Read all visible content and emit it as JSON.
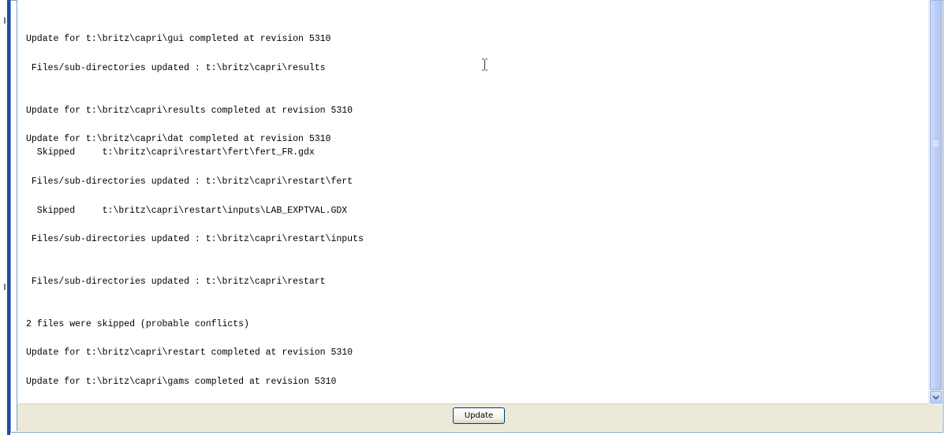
{
  "log": {
    "lines": [
      "Update for t:\\britz\\capri\\gui completed at revision 5310",
      " Files/sub-directories updated : t:\\britz\\capri\\results",
      "Update for t:\\britz\\capri\\results completed at revision 5310",
      "Update for t:\\britz\\capri\\dat completed at revision 5310",
      "  Skipped     t:\\britz\\capri\\restart\\fert\\fert_FR.gdx",
      " Files/sub-directories updated : t:\\britz\\capri\\restart\\fert",
      "  Skipped     t:\\britz\\capri\\restart\\inputs\\LAB_EXPTVAL.GDX",
      " Files/sub-directories updated : t:\\britz\\capri\\restart\\inputs",
      " Files/sub-directories updated : t:\\britz\\capri\\restart",
      "2 files were skipped (probable conflicts)",
      "Update for t:\\britz\\capri\\restart completed at revision 5310",
      "Update for t:\\britz\\capri\\gams completed at revision 5310"
    ]
  },
  "toolbar": {
    "update_label": "Update"
  },
  "icons": {
    "scroll_down": "chevron-down-icon",
    "cursor": "text-cursor-icon"
  },
  "colors": {
    "frame_blue": "#1f4aa8",
    "button_bar": "#ece9d8",
    "scrollbar_thumb": "#bccdf6"
  }
}
